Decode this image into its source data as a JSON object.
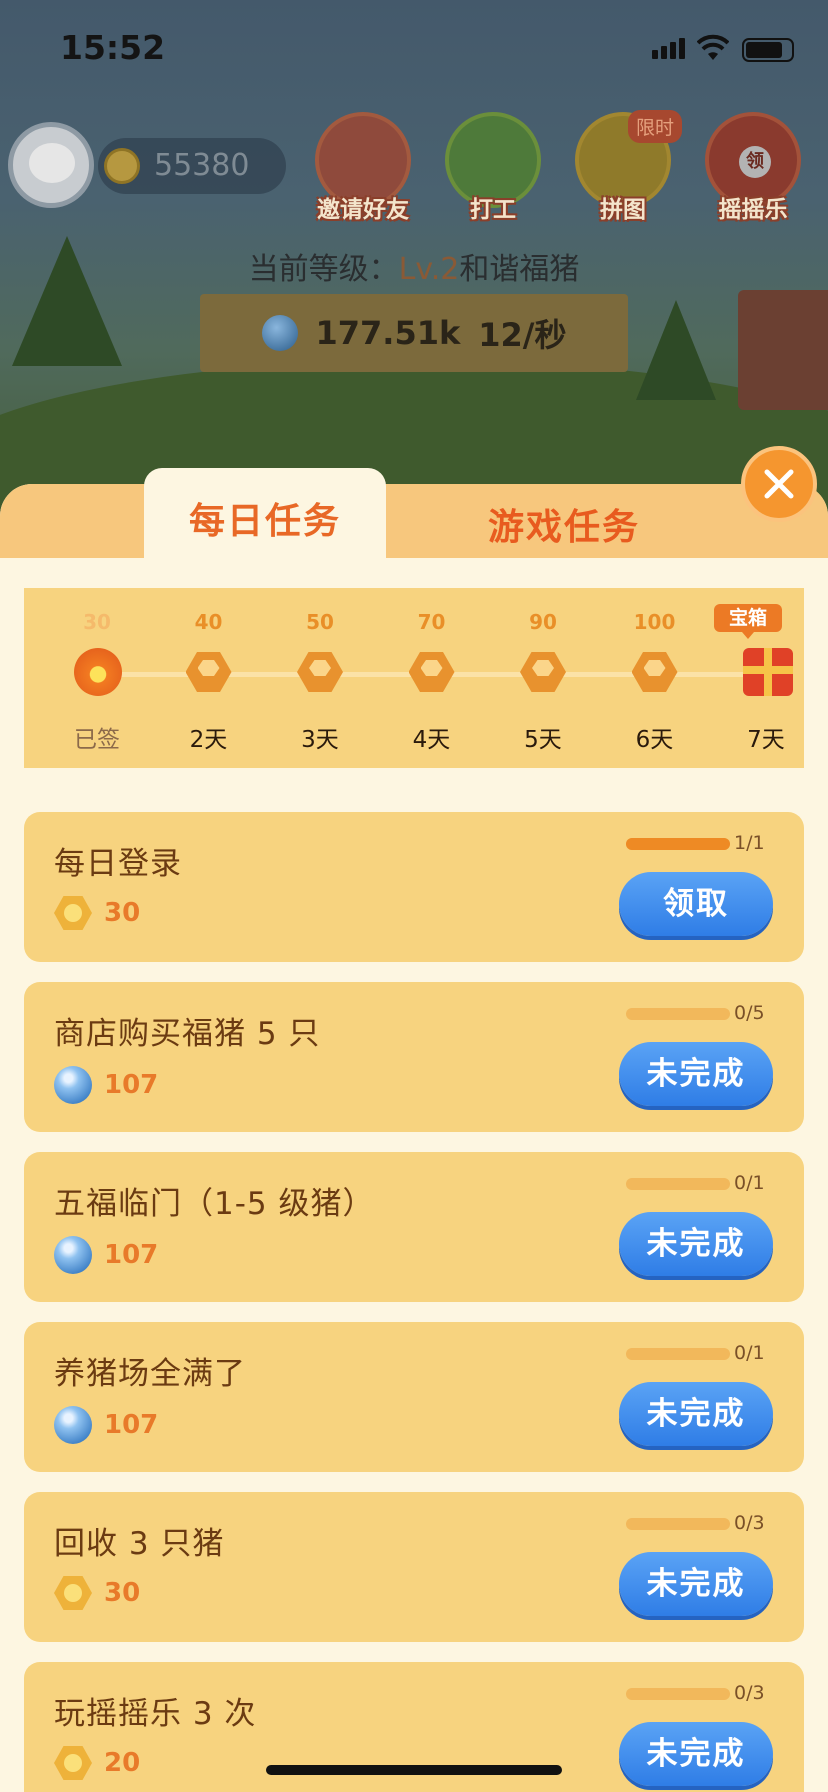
{
  "status_bar": {
    "time": "15:52"
  },
  "top": {
    "coins": "55380",
    "menu": [
      {
        "label": "邀请好友"
      },
      {
        "label": "打工"
      },
      {
        "label": "拼图",
        "tag": "限时"
      },
      {
        "label": "摇摇乐",
        "badge": "领"
      }
    ],
    "level_prefix": "当前等级：",
    "level_value": "Lv.2",
    "level_name": "和谐福猪",
    "rate_amount": "177.51k",
    "rate_speed": "12/秒"
  },
  "tabs": {
    "daily": "每日任务",
    "game": "游戏任务"
  },
  "signin": {
    "box_tag": "宝箱",
    "days": [
      {
        "points": "30",
        "label": "已签",
        "state": "signed"
      },
      {
        "points": "40",
        "label": "2天",
        "state": "coin"
      },
      {
        "points": "50",
        "label": "3天",
        "state": "coin"
      },
      {
        "points": "70",
        "label": "4天",
        "state": "coin"
      },
      {
        "points": "90",
        "label": "5天",
        "state": "coin"
      },
      {
        "points": "100",
        "label": "6天",
        "state": "coin"
      },
      {
        "points": "",
        "label": "7天",
        "state": "gift"
      }
    ]
  },
  "tasks": [
    {
      "title": "每日登录",
      "reward_icon": "coin",
      "reward": "30",
      "progress": "1/1",
      "progress_fraction": 1.0,
      "button": "领取"
    },
    {
      "title": "商店购买福猪 5 只",
      "reward_icon": "gem",
      "reward": "107",
      "progress": "0/5",
      "progress_fraction": 0,
      "button": "未完成"
    },
    {
      "title": "五福临门（1-5 级猪）",
      "reward_icon": "gem",
      "reward": "107",
      "progress": "0/1",
      "progress_fraction": 0,
      "button": "未完成"
    },
    {
      "title": "养猪场全满了",
      "reward_icon": "gem",
      "reward": "107",
      "progress": "0/1",
      "progress_fraction": 0,
      "button": "未完成"
    },
    {
      "title": "回收 3 只猪",
      "reward_icon": "coin",
      "reward": "30",
      "progress": "0/3",
      "progress_fraction": 0,
      "button": "未完成"
    },
    {
      "title": "玩摇摇乐 3 次",
      "reward_icon": "coin",
      "reward": "20",
      "progress": "0/3",
      "progress_fraction": 0,
      "button": "未完成"
    }
  ],
  "colors": {
    "accent": "#e86826",
    "button_blue": "#3b8cf0",
    "card": "#f7d37f"
  }
}
